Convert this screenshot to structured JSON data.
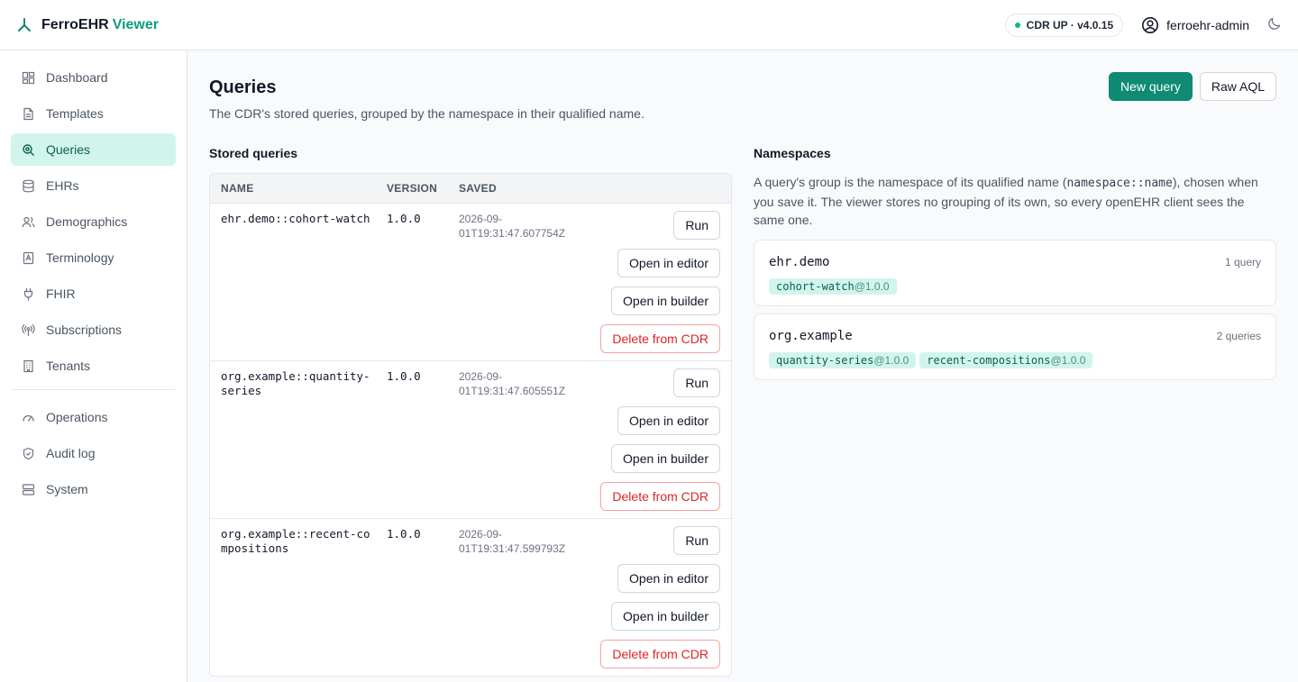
{
  "brand": {
    "name": "FerroEHR",
    "accent": "Viewer"
  },
  "status": {
    "label": "CDR UP · v4.0.15"
  },
  "user": {
    "name": "ferroehr-admin"
  },
  "sidebar": {
    "items": [
      {
        "label": "Dashboard",
        "icon": "dashboard-icon"
      },
      {
        "label": "Templates",
        "icon": "file-icon"
      },
      {
        "label": "Queries",
        "icon": "search-icon",
        "active": true
      },
      {
        "label": "EHRs",
        "icon": "database-icon"
      },
      {
        "label": "Demographics",
        "icon": "users-icon"
      },
      {
        "label": "Terminology",
        "icon": "book-icon"
      },
      {
        "label": "FHIR",
        "icon": "plug-icon"
      },
      {
        "label": "Subscriptions",
        "icon": "broadcast-icon"
      },
      {
        "label": "Tenants",
        "icon": "building-icon"
      }
    ],
    "secondary": [
      {
        "label": "Operations",
        "icon": "gauge-icon"
      },
      {
        "label": "Audit log",
        "icon": "shield-icon"
      },
      {
        "label": "System",
        "icon": "server-icon"
      }
    ]
  },
  "page": {
    "title": "Queries",
    "subtitle": "The CDR's stored queries, grouped by the namespace in their qualified name.",
    "new_query": "New query",
    "raw_aql": "Raw AQL"
  },
  "stored": {
    "title": "Stored queries",
    "headers": {
      "name": "NAME",
      "version": "VERSION",
      "saved": "SAVED"
    },
    "rows": [
      {
        "name": "ehr.demo::cohort-watch",
        "version": "1.0.0",
        "saved": "2026-09-01T19:31:47.607754Z"
      },
      {
        "name": "org.example::quantity-series",
        "version": "1.0.0",
        "saved": "2026-09-01T19:31:47.605551Z"
      },
      {
        "name": "org.example::recent-compositions",
        "version": "1.0.0",
        "saved": "2026-09-01T19:31:47.599793Z"
      }
    ],
    "actions": {
      "run": "Run",
      "editor": "Open in editor",
      "builder": "Open in builder",
      "delete": "Delete from CDR"
    }
  },
  "namespaces": {
    "title": "Namespaces",
    "intro_pre": "A query's group is the namespace of its qualified name (",
    "intro_code": "namespace::name",
    "intro_post": "), chosen when you save it. The viewer stores no grouping of its own, so every openEHR client sees the same one.",
    "groups": [
      {
        "name": "ehr.demo",
        "count": "1 query",
        "tags": [
          {
            "name": "cohort-watch",
            "version": "@1.0.0"
          }
        ]
      },
      {
        "name": "org.example",
        "count": "2 queries",
        "tags": [
          {
            "name": "quantity-series",
            "version": "@1.0.0"
          },
          {
            "name": "recent-compositions",
            "version": "@1.0.0"
          }
        ]
      }
    ]
  },
  "colors": {
    "accent": "#0f8a73",
    "active_bg": "#d1f5ec",
    "danger": "#dc2626"
  }
}
